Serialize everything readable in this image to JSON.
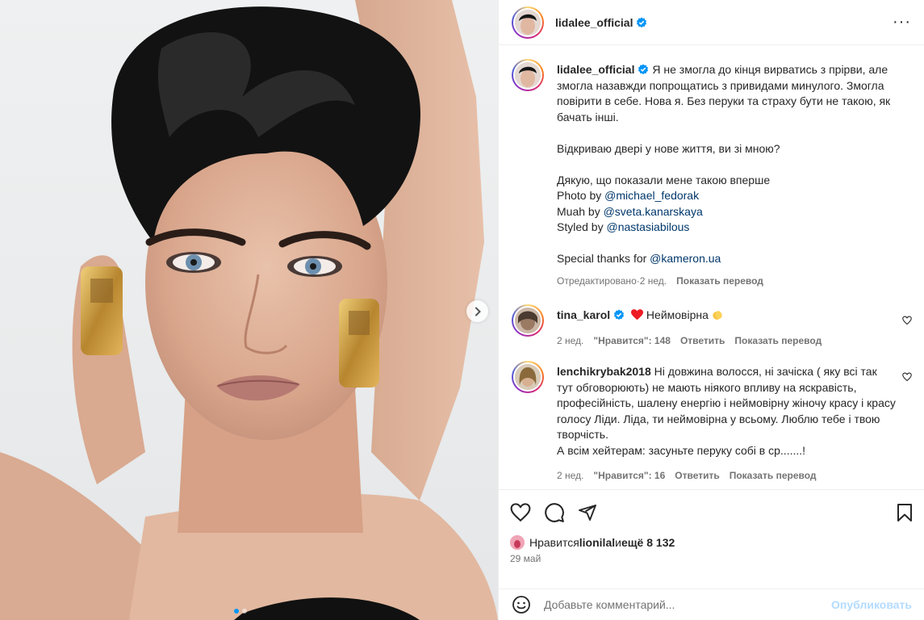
{
  "post": {
    "author": "lidalee_official",
    "verified_icon": "verified-badge-icon",
    "carousel": {
      "current": 1,
      "total": 2
    }
  },
  "caption": {
    "author": "lidalee_official",
    "lines": [
      "Я не змогла до кінця вирватись з прірви, але змогла назавжди попрощатись з привидами минулого. Змогла повірити в себе. Нова я. Без перуки та страху бути не такою, як бачать інші.",
      "Відкриваю двері у нове життя, ви зі мною?",
      "Дякую, що показали мене такою вперше"
    ],
    "credits": [
      {
        "prefix": "Photo by ",
        "mention": "@michael_fedorak"
      },
      {
        "prefix": "Muah by ",
        "mention": "@sveta.kanarskaya"
      },
      {
        "prefix": "Styled by ",
        "mention": "@nastasiabilous"
      }
    ],
    "thanks_prefix": "Special thanks for ",
    "thanks_mention": "@kameron.ua",
    "edited": "Отредактировано",
    "sep": " · ",
    "time": "2 нед.",
    "translate": "Показать перевод"
  },
  "comments": [
    {
      "author": "tina_karol",
      "verified": true,
      "text": " Неймовірна ",
      "time": "2 нед.",
      "likes_label": "\"Нравится\": 148",
      "reply": "Ответить",
      "translate": "Показать перевод"
    },
    {
      "author": "lenchikrybak2018",
      "verified": false,
      "text": "Ні довжина волосся, ні зачіска ( яку всі так тут обговорюють) не мають ніякого впливу на яскравість, професійність, шалену енергію і неймовірну жіночу красу і красу голосу Ліди. Ліда, ти неймовірна у всьому. Люблю тебе і твою творчість.",
      "text2": "А всім хейтерам: засуньте перуку собі в ср.......!",
      "time": "2 нед.",
      "likes_label": "\"Нравится\": 16",
      "reply": "Ответить",
      "translate": "Показать перевод"
    }
  ],
  "footer": {
    "liked_prefix": "Нравится ",
    "liked_user": "lionilal",
    "liked_and": " и ",
    "liked_rest": "ещё 8 132",
    "date": "29 май",
    "comment_placeholder": "Добавьте комментарий...",
    "post_label": "Опубликовать"
  },
  "colors": {
    "accent": "#0095f6",
    "link": "#00376b",
    "heart": "#ed1c24",
    "muted": "#737373"
  }
}
